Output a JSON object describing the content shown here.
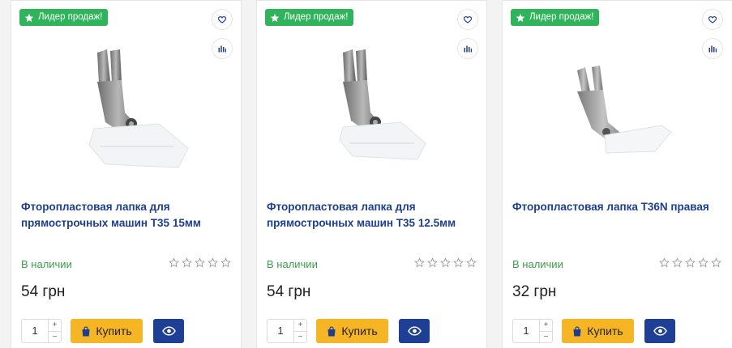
{
  "products": [
    {
      "badge": "Лидер продаж!",
      "title": "Фторопластовая лапка для прямострочных машин Т35 15мм",
      "stock": "В наличии",
      "price": "54 грн",
      "qty": "1",
      "buy_label": "Купить",
      "rating": 0,
      "max_rating": 5
    },
    {
      "badge": "Лидер продаж!",
      "title": "Фторопластовая лапка для прямострочных машин Т35 12.5мм",
      "stock": "В наличии",
      "price": "54 грн",
      "qty": "1",
      "buy_label": "Купить",
      "rating": 0,
      "max_rating": 5
    },
    {
      "badge": "Лидер продаж!",
      "title": "Фторопластовая лапка T36N правая",
      "stock": "В наличии",
      "price": "32 грн",
      "qty": "1",
      "buy_label": "Купить",
      "rating": 0,
      "max_rating": 5
    }
  ],
  "qty_plus": "+",
  "qty_minus": "−",
  "icons": {
    "badge": "star-icon",
    "favorite": "heart-icon",
    "compare": "bar-chart-icon",
    "rating": "star-outline-icon",
    "buy": "shopping-bag-icon",
    "quick_view": "eye-icon"
  },
  "colors": {
    "badge_bg": "#2fb45c",
    "title": "#1d3f8f",
    "stock": "#3aa04a",
    "buy_bg": "#f5b524",
    "view_bg": "#1f3e95"
  }
}
